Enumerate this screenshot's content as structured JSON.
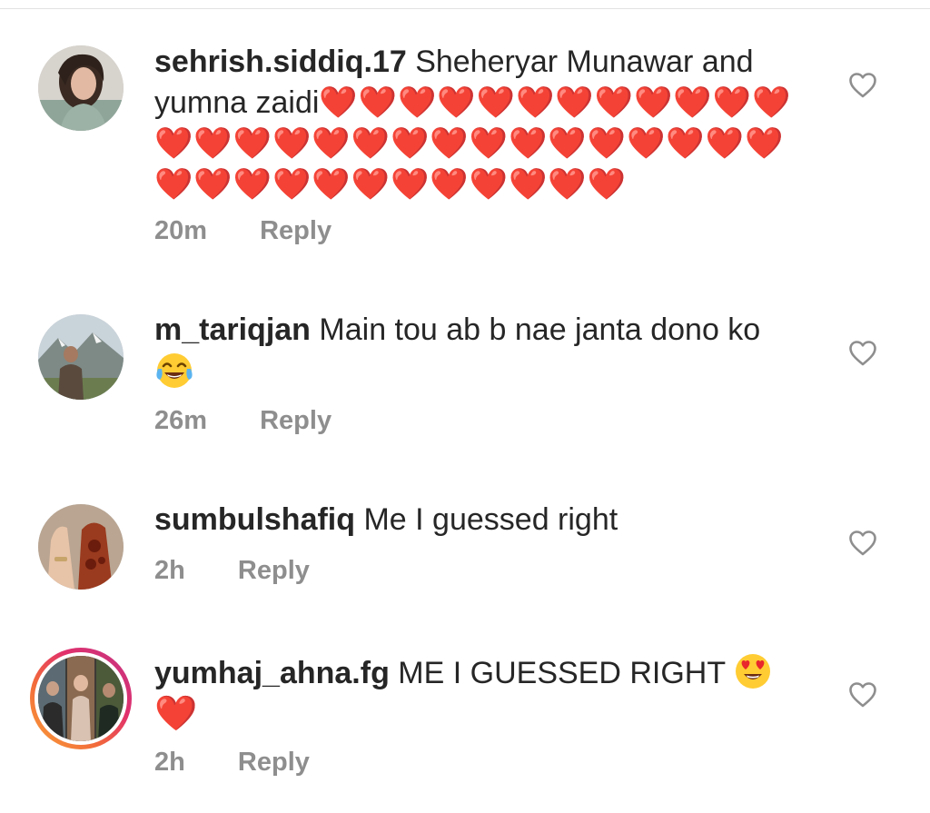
{
  "comments": [
    {
      "username": "sehrish.siddiq.17",
      "text": "Sheheryar Munawar and yumna zaidi",
      "emoji": "❤️❤️❤️❤️❤️❤️❤️❤️❤️❤️❤️❤️❤️❤️❤️❤️❤️❤️❤️❤️❤️❤️❤️❤️❤️❤️❤️❤️❤️❤️❤️❤️❤️❤️❤️❤️❤️❤️❤️❤️",
      "time": "20m",
      "reply": "Reply"
    },
    {
      "username": "m_tariqjan",
      "text": "Main tou ab b nae janta dono ko",
      "emoji": "😂",
      "time": "26m",
      "reply": "Reply"
    },
    {
      "username": "sumbulshafiq",
      "text": "Me I guessed right",
      "time": "2h",
      "reply": "Reply"
    },
    {
      "username": "yumhaj_ahna.fg",
      "text": "ME I GUESSED RIGHT",
      "emoji": "😍❤️",
      "time": "2h",
      "reply": "Reply"
    }
  ],
  "icons": {
    "like": "heart-outline-icon",
    "laugh": "tears-of-joy-emoji-icon",
    "heart_eyes": "heart-eyes-emoji-icon",
    "heart": "red-heart-emoji-icon"
  },
  "colors": {
    "username": "#262626",
    "text": "#262626",
    "meta": "#8e8e8e",
    "heart": "#ed2c36",
    "like_outline": "#8e8e8e",
    "story_ring_start": "#f9a23a",
    "story_ring_end": "#c13584"
  }
}
